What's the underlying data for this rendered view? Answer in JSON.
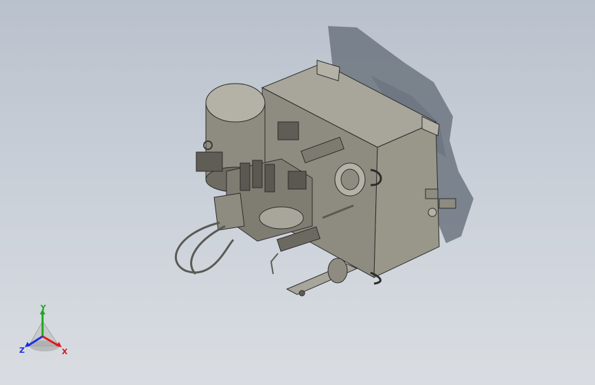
{
  "viewport": {
    "background_top": "#b9c1cc",
    "background_bottom": "#d9dde2"
  },
  "model": {
    "body_color": "#8e8c80",
    "body_dark": "#5f5d55",
    "body_light": "#b4b2a6",
    "shadow_color": "#6b737e",
    "edge_color": "#2b2b2b"
  },
  "triad": {
    "x_label": "X",
    "y_label": "Y",
    "z_label": "Z",
    "x_color": "#e01818",
    "y_color": "#1fa81f",
    "z_color": "#1c2fe0"
  }
}
